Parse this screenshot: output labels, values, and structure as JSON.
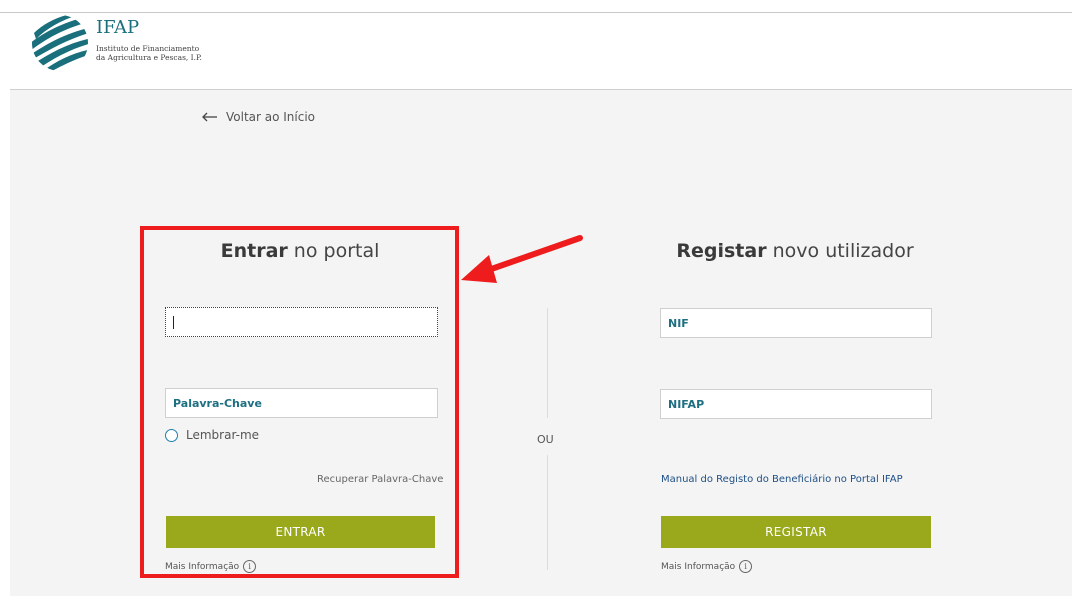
{
  "brand": {
    "name": "IFAP",
    "subtitle_line1": "Instituto de Financiamento",
    "subtitle_line2": "da Agricultura e Pescas, I.P.",
    "color": "#1a6f7d"
  },
  "nav": {
    "back_label": "Voltar ao Início"
  },
  "login": {
    "title_bold": "Entrar",
    "title_rest": " no portal",
    "username_value": "",
    "password_placeholder": "Palavra-Chave",
    "remember_label": "Lembrar-me",
    "recover_label": "Recuperar Palavra-Chave",
    "submit_label": "ENTRAR",
    "more_info_label": "Mais Informação"
  },
  "divider": {
    "label": "OU"
  },
  "register": {
    "title_bold": "Registar",
    "title_rest": " novo utilizador",
    "nif_placeholder": "NIF",
    "nifap_placeholder": "NIFAP",
    "manual_link": "Manual do Registo do Beneficiário no Portal IFAP",
    "submit_label": "REGISTAR",
    "more_info_label": "Mais Informação"
  },
  "colors": {
    "button": "#9aa91b",
    "highlight": "#ee1c1c",
    "field_text": "#1d6f82"
  },
  "icons": {
    "back": "arrow-left-icon",
    "info": "info-icon",
    "radio": "radio-unchecked-icon"
  }
}
